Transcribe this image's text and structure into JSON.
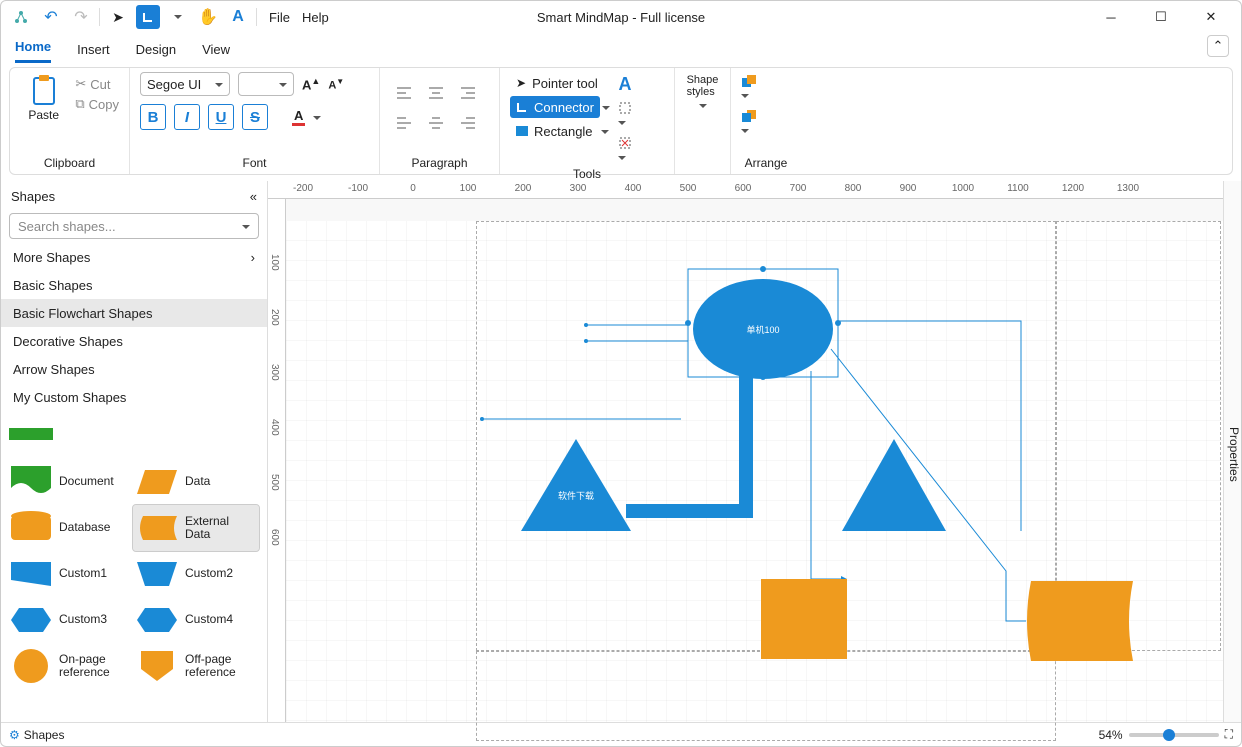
{
  "app": {
    "title": "Smart MindMap - Full license"
  },
  "qat_menu": {
    "file": "File",
    "help": "Help"
  },
  "tabs": {
    "home": "Home",
    "insert": "Insert",
    "design": "Design",
    "view": "View"
  },
  "ribbon": {
    "clipboard": {
      "label": "Clipboard",
      "paste": "Paste",
      "cut": "Cut",
      "copy": "Copy"
    },
    "font": {
      "label": "Font",
      "family": "Segoe UI",
      "size": "",
      "inc": "A",
      "dec": "A"
    },
    "paragraph": {
      "label": "Paragraph"
    },
    "tools": {
      "label": "Tools",
      "pointer": "Pointer tool",
      "connector": "Connector",
      "rectangle": "Rectangle",
      "text_glyph": "A"
    },
    "shape_styles": {
      "label": "Shape\nstyles",
      "btn": "Shape styles"
    },
    "arrange": {
      "label": "Arrange"
    }
  },
  "sidebar": {
    "title": "Shapes",
    "search_placeholder": "Search shapes...",
    "categories": {
      "more": "More Shapes",
      "basic": "Basic Shapes",
      "flow": "Basic Flowchart Shapes",
      "decor": "Decorative Shapes",
      "arrow": "Arrow Shapes",
      "custom": "My Custom Shapes"
    },
    "shapes": {
      "document": "Document",
      "data": "Data",
      "database": "Database",
      "external": "External Data",
      "custom1": "Custom1",
      "custom2": "Custom2",
      "custom3": "Custom3",
      "custom4": "Custom4",
      "onpage": "On-page reference",
      "offpage": "Off-page reference"
    }
  },
  "canvas": {
    "nodes": {
      "root": "单机100",
      "tri_left": "软件下载"
    },
    "ruler_h": [
      "-200",
      "-100",
      "0",
      "100",
      "200",
      "300",
      "400",
      "500",
      "600",
      "700",
      "800",
      "900",
      "1000",
      "1100",
      "1200",
      "1300"
    ],
    "ruler_v": [
      "100",
      "200",
      "300",
      "400",
      "500",
      "600"
    ]
  },
  "properties_panel": "Properties",
  "statusbar": {
    "shapes_btn": "Shapes",
    "zoom": "54%"
  },
  "colors": {
    "blue": "#1a8ad6",
    "orange": "#ef9b1e",
    "green": "#2ca02c"
  }
}
